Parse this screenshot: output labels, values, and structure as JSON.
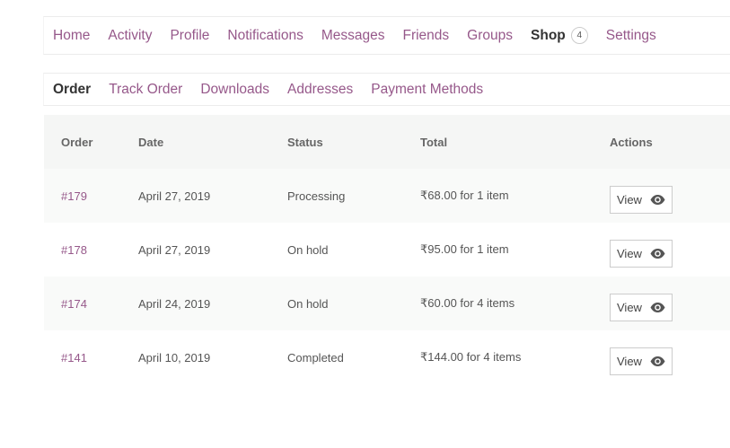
{
  "primary_nav": [
    {
      "label": "Home"
    },
    {
      "label": "Activity"
    },
    {
      "label": "Profile"
    },
    {
      "label": "Notifications"
    },
    {
      "label": "Messages"
    },
    {
      "label": "Friends"
    },
    {
      "label": "Groups"
    },
    {
      "label": "Shop",
      "badge": "4"
    },
    {
      "label": "Settings"
    }
  ],
  "secondary_nav": [
    {
      "label": "Order"
    },
    {
      "label": "Track Order"
    },
    {
      "label": "Downloads"
    },
    {
      "label": "Addresses"
    },
    {
      "label": "Payment Methods"
    }
  ],
  "table": {
    "headers": {
      "order": "Order",
      "date": "Date",
      "status": "Status",
      "total": "Total",
      "actions": "Actions"
    },
    "rows": [
      {
        "order": "#179",
        "date": "April 27, 2019",
        "status": "Processing",
        "total": "₹68.00 for 1 item",
        "action": "View"
      },
      {
        "order": "#178",
        "date": "April 27, 2019",
        "status": "On hold",
        "total": "₹95.00 for 1 item",
        "action": "View"
      },
      {
        "order": "#174",
        "date": "April 24, 2019",
        "status": "On hold",
        "total": "₹60.00 for 4 items",
        "action": "View"
      },
      {
        "order": "#141",
        "date": "April 10, 2019",
        "status": "Completed",
        "total": "₹144.00 for 4 items",
        "action": "View"
      }
    ]
  },
  "colors": {
    "link": "#96588a",
    "active": "#333333"
  },
  "icons": {
    "view": "eye-icon"
  }
}
